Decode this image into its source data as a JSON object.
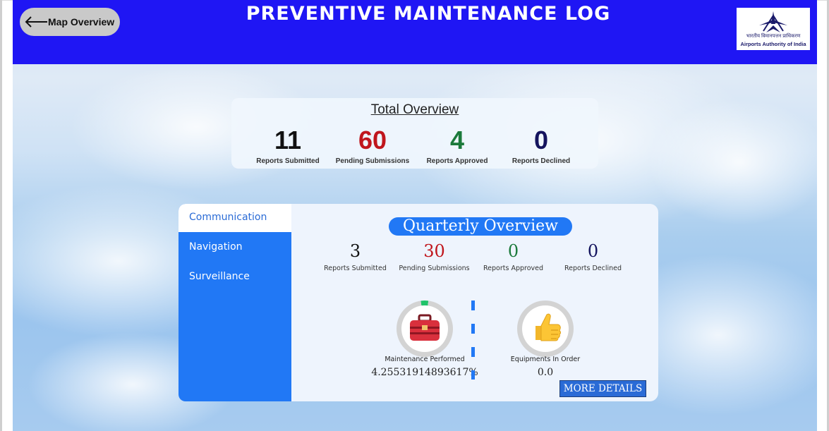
{
  "header": {
    "back_label": "Map Overview",
    "title": "PREVENTIVE MAINTENANCE LOG",
    "logo_hindi": "भारतीय विमानपत्तन प्राधिकरण",
    "logo_english": "Airports Authority of India"
  },
  "total_overview": {
    "title": "Total Overview",
    "stats": [
      {
        "value": "11",
        "label": "Reports Submitted",
        "color": "#111111"
      },
      {
        "value": "60",
        "label": "Pending Submissions",
        "color": "#c0161d"
      },
      {
        "value": "4",
        "label": "Reports Approved",
        "color": "#1b7a3b"
      },
      {
        "value": "0",
        "label": "Reports Declined",
        "color": "#14145e"
      }
    ]
  },
  "sidebar": {
    "items": [
      {
        "label": "Communication",
        "active": true
      },
      {
        "label": "Navigation",
        "active": false
      },
      {
        "label": "Surveillance",
        "active": false
      }
    ]
  },
  "quarterly_overview": {
    "title": "Quarterly Overview",
    "stats": [
      {
        "value": "3",
        "label": "Reports Submitted",
        "color": "#111111"
      },
      {
        "value": "30",
        "label": "Pending Submissions",
        "color": "#c0161d"
      },
      {
        "value": "0",
        "label": "Reports Approved",
        "color": "#1b7a3b"
      },
      {
        "value": "0",
        "label": "Reports Declined",
        "color": "#14145e"
      }
    ],
    "gauges": [
      {
        "caption": "Maintenance Performed",
        "value": "4.25531914893617%",
        "fraction": 0.0426,
        "icon": "toolbox-icon",
        "fill_color": "#22c46a"
      },
      {
        "caption": "Equipments In Order",
        "value": "0.0",
        "fraction": 0.0,
        "icon": "thumbs-up-icon",
        "fill_color": "#22c46a"
      }
    ],
    "more_button_label": "MORE DETAILS"
  },
  "colors": {
    "header_bg": "#1f16f4",
    "accent": "#2178f5"
  }
}
